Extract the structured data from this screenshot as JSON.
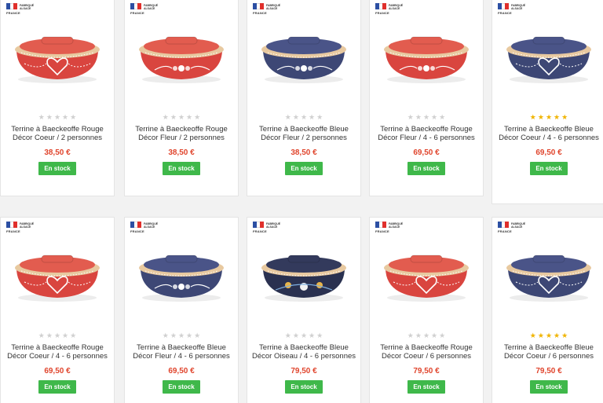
{
  "flag_country": "FRANCE",
  "origin_label": "FABRIQUÉ ALSACE",
  "stock_label": "En stock",
  "products": [
    {
      "title": "Terrine à Baeckeoffe Rouge Décor Coeur / 2 personnes",
      "price": "38,50 €",
      "rated": false,
      "rating": 0,
      "color": "red",
      "decor": "coeur"
    },
    {
      "title": "Terrine à Baeckeoffe Rouge Décor Fleur / 2 personnes",
      "price": "38,50 €",
      "rated": false,
      "rating": 0,
      "color": "red",
      "decor": "fleur"
    },
    {
      "title": "Terrine à Baeckeoffe Bleue Décor Fleur / 2 personnes",
      "price": "38,50 €",
      "rated": false,
      "rating": 0,
      "color": "blue",
      "decor": "fleur"
    },
    {
      "title": "Terrine à Baeckeoffe Rouge Décor Fleur / 4 - 6 personnes",
      "price": "69,50 €",
      "rated": false,
      "rating": 0,
      "color": "red",
      "decor": "fleur"
    },
    {
      "title": "Terrine à Baeckeoffe Bleue Décor Coeur / 4 - 6 personnes",
      "price": "69,50 €",
      "rated": true,
      "rating": 5,
      "color": "blue",
      "decor": "coeur"
    },
    {
      "title": "Terrine à Baeckeoffe Rouge Décor Coeur / 4 - 6 personnes",
      "price": "69,50 €",
      "rated": false,
      "rating": 0,
      "color": "red",
      "decor": "coeur"
    },
    {
      "title": "Terrine à Baeckeoffe Bleue Décor Fleur / 4 - 6 personnes",
      "price": "69,50 €",
      "rated": false,
      "rating": 0,
      "color": "blue",
      "decor": "fleur"
    },
    {
      "title": "Terrine à Baeckeoffe Bleue Décor Oiseau / 4 - 6 personnes",
      "price": "79,50 €",
      "rated": false,
      "rating": 0,
      "color": "navy",
      "decor": "oiseau"
    },
    {
      "title": "Terrine à Baeckeoffe Rouge Décor Coeur / 6 personnes",
      "price": "79,50 €",
      "rated": false,
      "rating": 0,
      "color": "red",
      "decor": "coeur"
    },
    {
      "title": "Terrine à Baeckeoffe Bleue Décor Coeur / 6 personnes",
      "price": "79,50 €",
      "rated": true,
      "rating": 5,
      "color": "blue",
      "decor": "coeur"
    }
  ],
  "colors": {
    "red": "#d9453f",
    "blue": "#3d4775",
    "navy": "#2a3150",
    "star": "#f0b400",
    "price": "#e0452d",
    "stock": "#3fb84a"
  }
}
